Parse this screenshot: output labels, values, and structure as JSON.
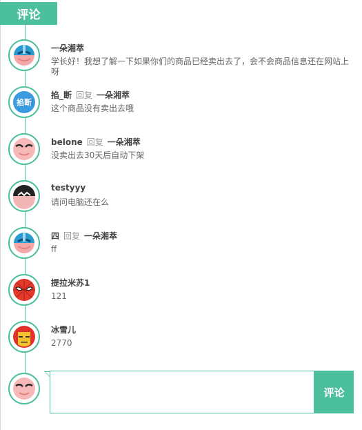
{
  "header": {
    "title": "评论"
  },
  "comments": [
    {
      "author": "一朵湘萃",
      "reply": null,
      "text": "学长好！我想了解一下如果你们的商品已经卖出去了，会不会商品信息还在网站上呀",
      "avatar": "blue-masked-hero-icon"
    },
    {
      "author": "掐_断",
      "reply": {
        "word": "回复",
        "target": "一朵湘萃"
      },
      "text": "这个商品没有卖出去哦",
      "avatar": "blue-badge-avatar-icon",
      "avatar_text": "掐断"
    },
    {
      "author": "belone",
      "reply": {
        "word": "回复",
        "target": "一朵湘萃"
      },
      "text": "没卖出去30天后自动下架",
      "avatar": "pink-masked-hero-icon"
    },
    {
      "author": "testyyy",
      "reply": null,
      "text": "请问电脑还在么",
      "avatar": "black-masked-hero-icon"
    },
    {
      "author": "四",
      "reply": {
        "word": "回复",
        "target": "一朵湘萃"
      },
      "text": "ff",
      "avatar": "blue-masked-hero-icon"
    },
    {
      "author": "提拉米苏1",
      "reply": null,
      "text": "121",
      "avatar": "spider-hero-icon"
    },
    {
      "author": "冰雪儿",
      "reply": null,
      "text": "2770",
      "avatar": "iron-hero-icon"
    }
  ],
  "compose": {
    "submit_label": "评论",
    "placeholder": "",
    "value": "",
    "avatar": "pink-masked-hero-icon"
  },
  "colors": {
    "accent": "#4cbf9c"
  }
}
